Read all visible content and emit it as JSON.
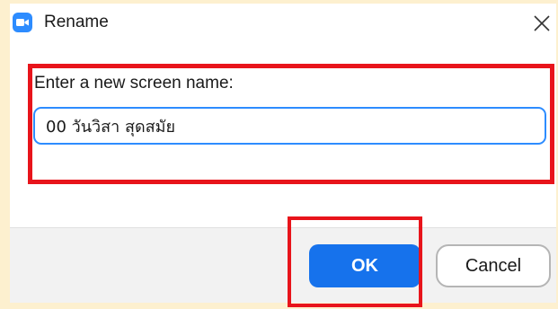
{
  "dialog": {
    "title": "Rename",
    "app_icon": "zoom-camera-icon",
    "close_icon": "close-icon"
  },
  "form": {
    "prompt": "Enter a new screen name:",
    "name_value": "00 วันวิสา สุดสมัย"
  },
  "footer": {
    "ok_label": "OK",
    "cancel_label": "Cancel"
  },
  "colors": {
    "accent": "#1672ec",
    "annotation_highlight": "#e8141b",
    "page_background": "#fdf0cf"
  }
}
